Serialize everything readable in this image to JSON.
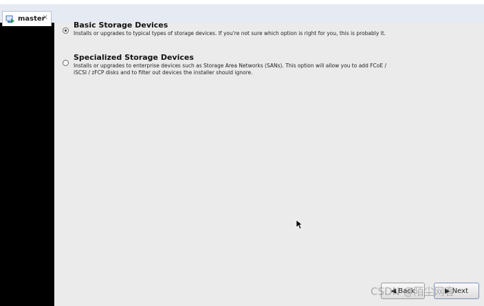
{
  "tab": {
    "label": "master",
    "close": "×",
    "icon": "vm-running-icon"
  },
  "installer": {
    "options": [
      {
        "title": "Basic Storage Devices",
        "description": "Installs or upgrades to typical types of storage devices.  If you're not sure which option is right for you, this is probably it.",
        "selected": true
      },
      {
        "title": "Specialized Storage Devices",
        "description": "Installs or upgrades to enterprise devices such as Storage Area Networks (SANs). This option will allow you to add FCoE / iSCSI / zFCP disks and to filter out devices the installer should ignore.",
        "selected": false
      }
    ],
    "buttons": {
      "back": "Back",
      "next": "Next"
    }
  },
  "watermark": "CSDN @陌尘网客"
}
